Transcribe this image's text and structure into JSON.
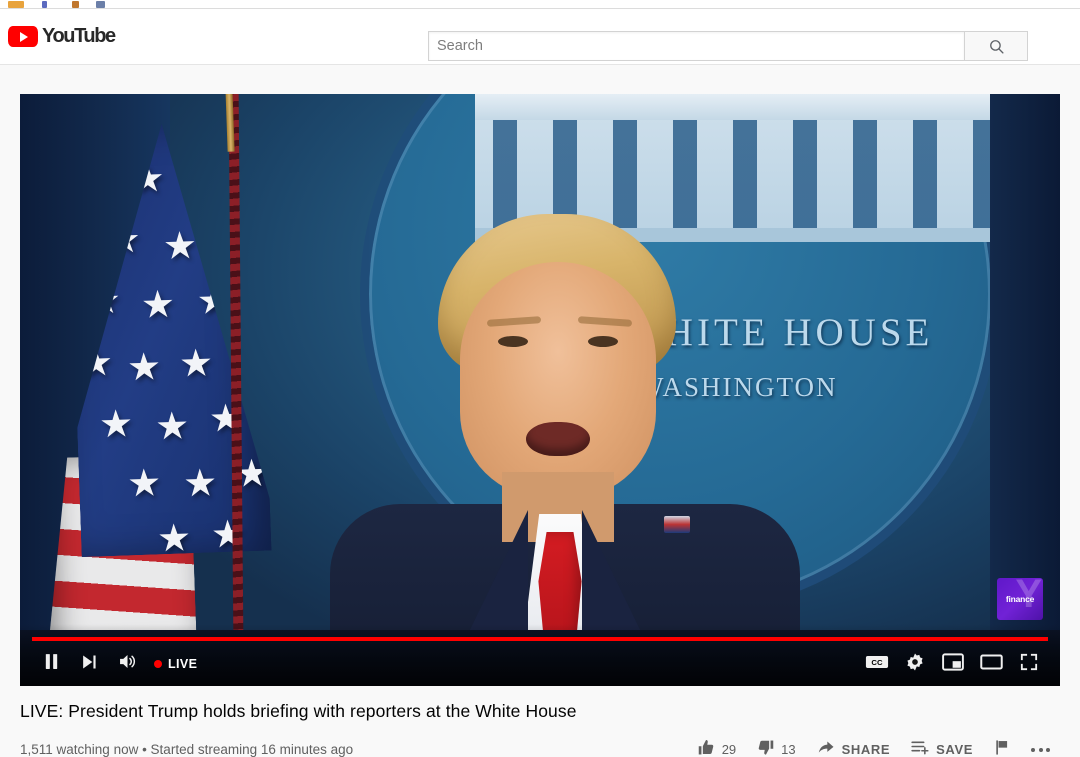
{
  "browser": {
    "bookmark_icons": [
      "bookmark-icon-1",
      "bookmark-icon-2",
      "bookmark-icon-3",
      "bookmark-icon-4"
    ]
  },
  "header": {
    "logo_text": "YouTube",
    "logo_icon": "youtube-play-icon",
    "search": {
      "placeholder": "Search",
      "value": "",
      "button_icon": "search-icon"
    }
  },
  "player": {
    "state": "playing",
    "is_live": true,
    "live_label": "LIVE",
    "progress_percent": 100,
    "scene": {
      "backdrop_text_line1": "WHITE HOUSE",
      "backdrop_text_line2": "WASHINGTON",
      "watermark_label": "finance",
      "watermark_mark": "Y",
      "watermark_color": "#6a1cd0"
    },
    "controls_left": [
      {
        "name": "pause-button",
        "icon": "pause-icon"
      },
      {
        "name": "next-button",
        "icon": "next-track-icon"
      },
      {
        "name": "volume-button",
        "icon": "volume-high-icon"
      }
    ],
    "controls_right": [
      {
        "name": "captions-button",
        "icon": "closed-captions-icon"
      },
      {
        "name": "settings-button",
        "icon": "gear-icon"
      },
      {
        "name": "miniplayer-button",
        "icon": "miniplayer-icon"
      },
      {
        "name": "theater-button",
        "icon": "theater-mode-icon"
      },
      {
        "name": "fullscreen-button",
        "icon": "fullscreen-icon"
      }
    ]
  },
  "video": {
    "title": "LIVE: President Trump holds briefing with reporters at the White House",
    "watching_now": "1,511 watching now",
    "separator": " • ",
    "started": "Started streaming 16 minutes ago",
    "meta_line": "1,511 watching now • Started streaming 16 minutes ago"
  },
  "actions": {
    "like": {
      "label": "",
      "count": "29",
      "icon": "thumbs-up-icon"
    },
    "dislike": {
      "label": "",
      "count": "13",
      "icon": "thumbs-down-icon"
    },
    "share": {
      "label": "SHARE",
      "icon": "share-arrow-icon"
    },
    "save": {
      "label": "SAVE",
      "icon": "add-to-playlist-icon"
    },
    "report": {
      "label": "",
      "icon": "flag-icon"
    },
    "more": {
      "label": "",
      "icon": "more-horizontal-icon"
    }
  },
  "colors": {
    "brand_red": "#ff0000",
    "page_bg": "#f9f9f9",
    "text_primary": "#030303",
    "text_secondary": "#606060"
  }
}
